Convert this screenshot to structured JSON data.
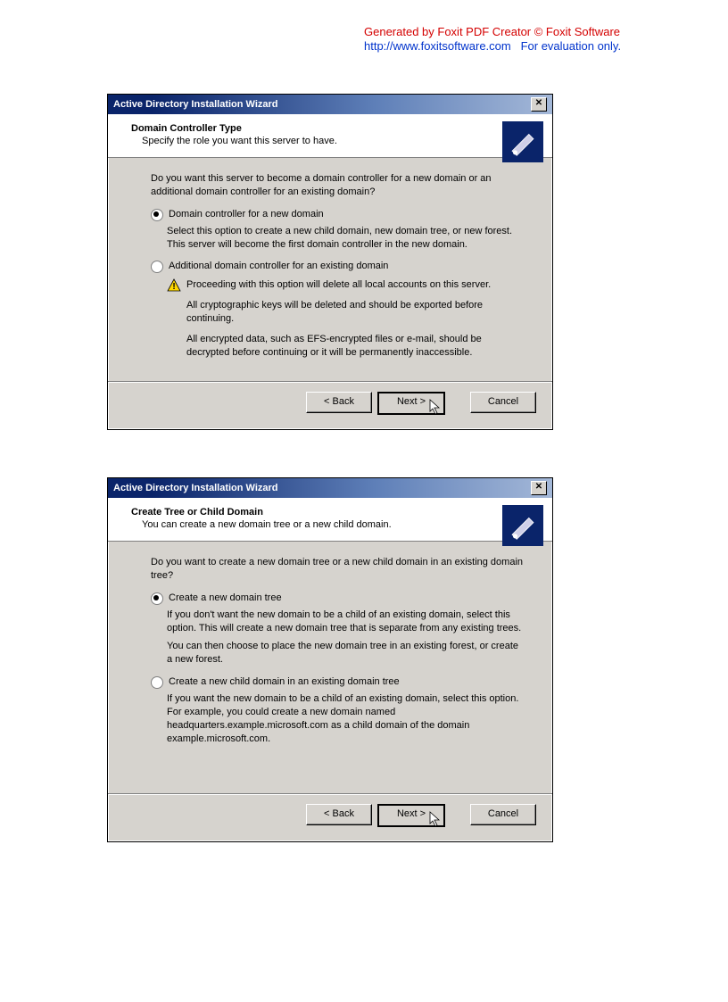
{
  "watermark": {
    "line1": "Generated by Foxit PDF Creator © Foxit Software",
    "line2a": "http://www.foxitsoftware.com",
    "line2b": "For evaluation only."
  },
  "dialog1": {
    "title": "Active Directory Installation Wizard",
    "header_title": "Domain Controller Type",
    "header_sub": "Specify the role you want this server to have.",
    "intro": "Do you want this server to become a domain controller for a new domain or an additional domain controller for an existing domain?",
    "option1_label": "Domain controller for a new domain",
    "option1_desc": "Select this option to create a new child domain, new domain tree, or new forest. This server will become the first domain controller in the new domain.",
    "option2_label": "Additional domain controller for an existing domain",
    "warn1": "Proceeding with this option will delete all local accounts on this server.",
    "warn2": "All cryptographic keys will be deleted and should be exported before continuing.",
    "warn3": "All encrypted data, such as EFS-encrypted files or e-mail, should be decrypted before continuing or it will be permanently inaccessible.",
    "back": "< Back",
    "next": "Next >",
    "cancel": "Cancel"
  },
  "dialog2": {
    "title": "Active Directory Installation Wizard",
    "header_title": "Create Tree or Child Domain",
    "header_sub": "You can create a new domain tree or a new child domain.",
    "intro": "Do you want to create a new domain tree or a new child domain in an existing domain tree?",
    "option1_label": "Create a new domain tree",
    "option1_desc1": "If you don't want the new domain to be a child of an existing domain, select this option.  This will create a new domain tree that is separate from any existing trees.",
    "option1_desc2": "You can then choose to place the new domain tree in an existing forest, or create a new forest.",
    "option2_label": "Create a new child domain in an existing domain tree",
    "option2_desc": "If you want the new domain to be a child of an existing domain, select this option. For example, you could create a new domain named headquarters.example.microsoft.com as a child domain of the domain example.microsoft.com.",
    "back": "< Back",
    "next": "Next >",
    "cancel": "Cancel"
  }
}
